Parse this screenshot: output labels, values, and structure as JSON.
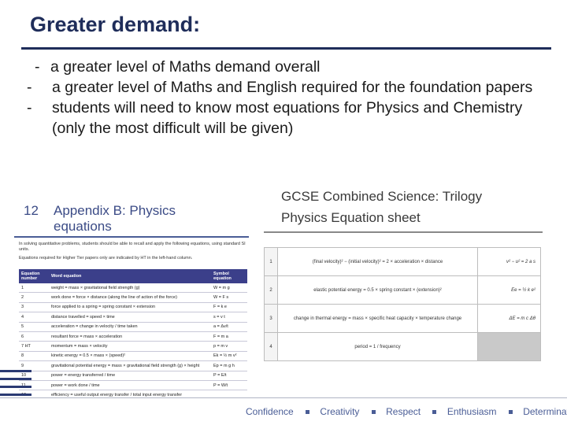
{
  "slide": {
    "title": "Greater demand:",
    "bullets": [
      {
        "dash": "-",
        "text": "a greater level of Maths demand overall"
      },
      {
        "dash": "-",
        "text": "a greater level of Maths and English required for the foundation papers"
      },
      {
        "dash": "-",
        "text": "students will need to know most equations for Physics and Chemistry (only the most difficult will be given)"
      }
    ]
  },
  "appendix": {
    "number": "12",
    "title": "Appendix B: Physics equations",
    "intro": "In solving quantitative problems, students should be able to recall and apply the following equations, using standard SI units.",
    "intro2": "Equations required for Higher Tier papers only are indicated by HT in the left-hand column.",
    "headers": [
      "Equation number",
      "Word equation",
      "Symbol equation"
    ],
    "rows": [
      [
        "1",
        "weight = mass × gravitational field strength (g)",
        "W = m g"
      ],
      [
        "2",
        "work done = force × distance (along the line of action of the force)",
        "W = F s"
      ],
      [
        "3",
        "force applied to a spring = spring constant × extension",
        "F = k e"
      ],
      [
        "4",
        "distance travelled = speed × time",
        "s = v t"
      ],
      [
        "5",
        "acceleration = change in velocity / time taken",
        "a = Δv/t"
      ],
      [
        "6",
        "resultant force = mass × acceleration",
        "F = m a"
      ],
      [
        "7 HT",
        "momentum = mass × velocity",
        "p = m v"
      ],
      [
        "8",
        "kinetic energy = 0.5 × mass × (speed)²",
        "Ek = ½ m v²"
      ],
      [
        "9",
        "gravitational potential energy = mass × gravitational field strength (g) × height",
        "Ep = m g h"
      ],
      [
        "10",
        "power = energy transferred / time",
        "P = E/t"
      ],
      [
        "11",
        "power = work done / time",
        "P = W/t"
      ],
      [
        "12",
        "efficiency = useful output energy transfer / total input energy transfer",
        ""
      ],
      [
        "13",
        "",
        ""
      ]
    ]
  },
  "sheet": {
    "title_line1": "GCSE Combined Science: Trilogy",
    "title_line2": "Physics Equation sheet",
    "rows": [
      {
        "n": "1",
        "word": "(final velocity)² − (initial velocity)² = 2 × acceleration × distance",
        "sym": "v² − u² = 2 a s"
      },
      {
        "n": "2",
        "word": "elastic potential energy = 0.5 × spring constant × (extension)²",
        "sym": "Ee = ½ k e²"
      },
      {
        "n": "3",
        "word": "change in thermal energy = mass × specific heat capacity × temperature change",
        "sym": "ΔE = m c Δθ"
      },
      {
        "n": "4",
        "word": "period = 1 / frequency",
        "sym": ""
      }
    ]
  },
  "footer": {
    "values": [
      "Confidence",
      "Creativity",
      "Respect",
      "Enthusiasm",
      "Determination"
    ],
    "color": "#4a5d96"
  }
}
